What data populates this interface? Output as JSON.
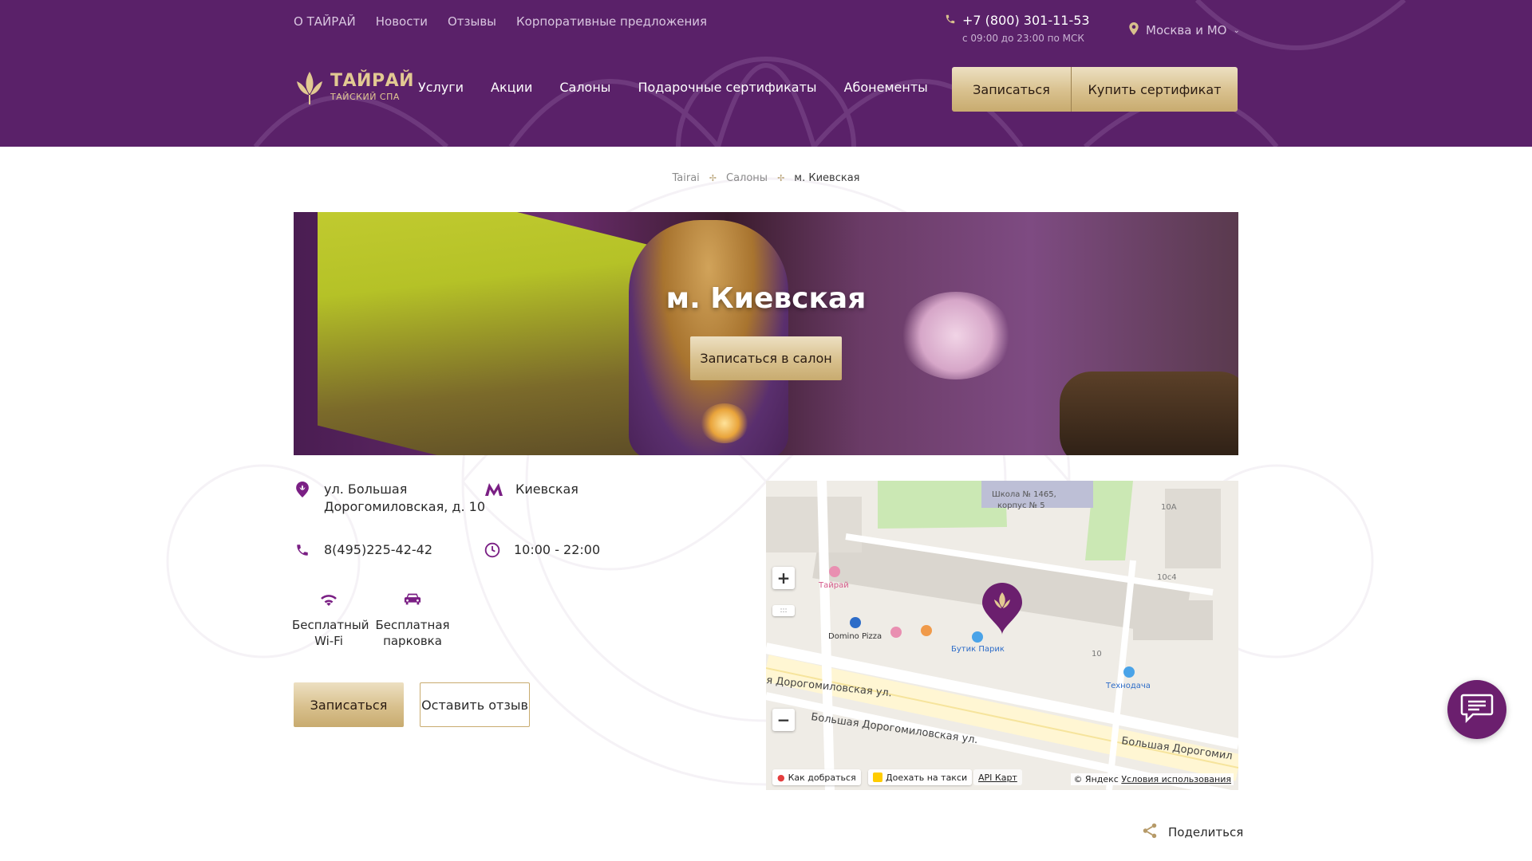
{
  "header": {
    "top_links": [
      "О ТАЙРАЙ",
      "Новости",
      "Отзывы",
      "Корпоративные предложения"
    ],
    "phone": "+7 (800) 301-11-53",
    "hours": "с 09:00 до 23:00 по МСК",
    "city": "Москва и МО",
    "logo_title": "ТАЙРАЙ",
    "logo_subtitle": "ТАЙСКИЙ СПА",
    "nav": [
      "Услуги",
      "Акции",
      "Салоны",
      "Подарочные сертификаты",
      "Абонементы"
    ],
    "book_label": "Записаться",
    "certificate_label": "Купить сертификат",
    "colors": {
      "header_bg": "#5a2169",
      "gold": "#d8c08d",
      "accent": "#7a1f84"
    }
  },
  "breadcrumb": [
    "Tairai",
    "Салоны",
    "м. Киевская"
  ],
  "hero": {
    "title": "м. Киевская",
    "button": "Записаться в салон"
  },
  "info": {
    "address": "ул. Большая Дорогомиловская, д. 10",
    "address_line1": "ул. Большая",
    "address_line2": "Дорогомиловская, д. 10",
    "metro": "Киевская",
    "phone": "8(495)225-42-42",
    "hours": "10:00 - 22:00",
    "amenities": [
      {
        "line1": "Бесплатный",
        "line2": "Wi-Fi",
        "icon": "wifi-icon"
      },
      {
        "line1": "Бесплатная",
        "line2": "парковка",
        "icon": "car-icon"
      }
    ],
    "book_label": "Записаться",
    "review_label": "Оставить отзыв"
  },
  "map": {
    "labels": {
      "school": "Школа № 1465,",
      "school2": "корпус № 5",
      "b10a": "10А",
      "b10c4": "10с4",
      "tairai": "Тайрай",
      "domino": "Domino Pizza",
      "butik": "Бутик Парик",
      "tehnodacha": "Технодача",
      "b10": "10",
      "street1": "я Дорогомиловская ул.",
      "street2": "Большая Дорогомиловская ул.",
      "street3": "Большая Дорогомил"
    },
    "how_to_get": "Как добраться",
    "taxi": "Доехать на такси",
    "api": "API Карт",
    "copyright": "© Яндекс",
    "terms": "Условия использования"
  },
  "share_label": "Поделиться"
}
